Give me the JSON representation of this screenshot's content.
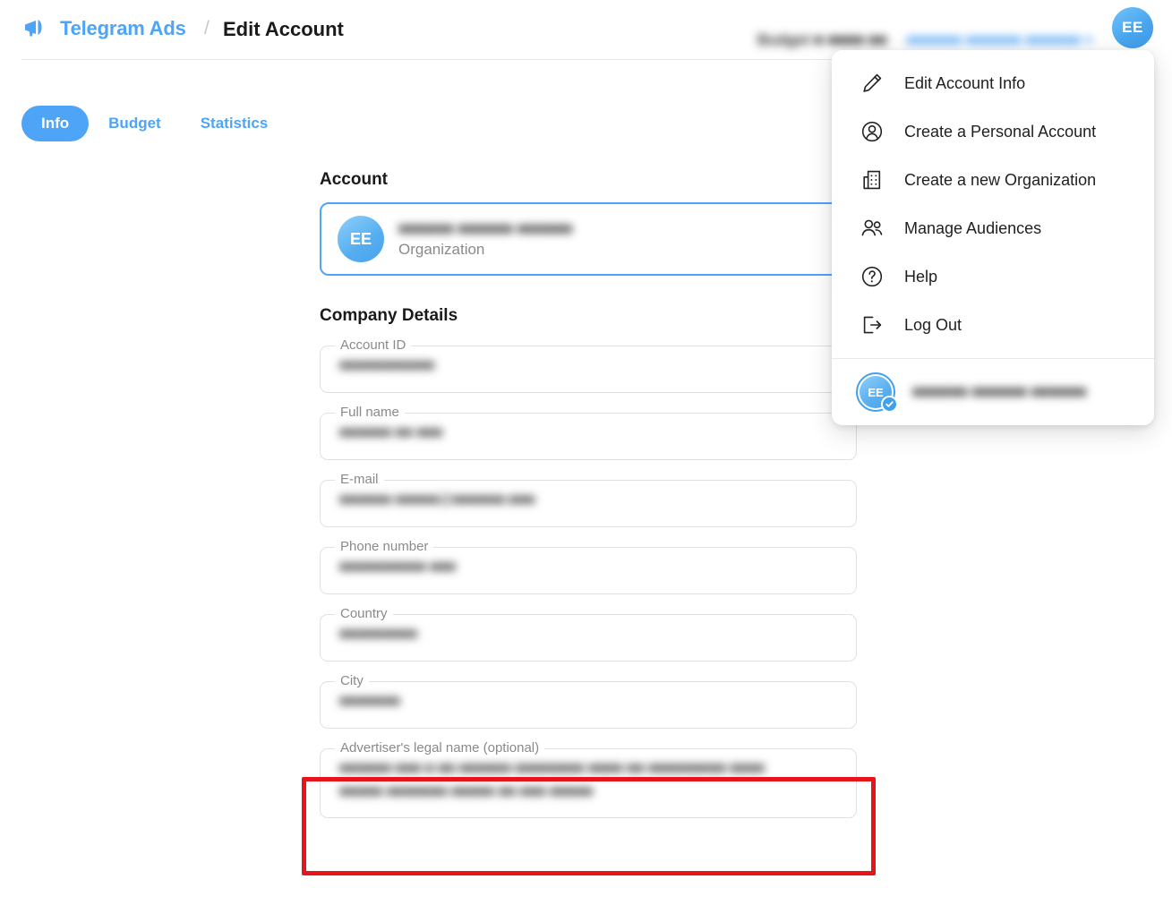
{
  "header": {
    "brand": "Telegram Ads",
    "breadcrumb_separator": "/",
    "page_title": "Edit Account",
    "logo_icon": "megaphone-icon",
    "budget_label_redacted": "Budget  ■ ■■■■ ■■",
    "account_name_redacted": "■■■■■■ ■■■■■■ ■■■■■■ ▾",
    "avatar_initials": "EE"
  },
  "tabs": [
    {
      "label": "Info",
      "active": true
    },
    {
      "label": "Budget",
      "active": false
    },
    {
      "label": "Statistics",
      "active": false
    }
  ],
  "main": {
    "account_section_title": "Account",
    "account_card": {
      "avatar_initials": "EE",
      "name_redacted": "■■■■■■ ■■■■■■ ■■■■■■",
      "type": "Organization"
    },
    "company_section_title": "Company Details",
    "fields": [
      {
        "label": "Account ID",
        "value_redacted": "■■■■■■■■■■■",
        "tall": false
      },
      {
        "label": "Full name",
        "value_redacted": "■■■■■■ ■■ ■■■",
        "tall": false
      },
      {
        "label": "E-mail",
        "value_redacted": "■■■■■■ ■■■■■@■■■■■■.■■■",
        "tall": false
      },
      {
        "label": "Phone number",
        "value_redacted": "■■■■■■■■■■ ■■■",
        "tall": false
      },
      {
        "label": "Country",
        "value_redacted": "■■■■■■■■■",
        "tall": false
      },
      {
        "label": "City",
        "value_redacted": "■■■■■■■",
        "tall": false
      },
      {
        "label": "Advertiser's legal name (optional)",
        "value_redacted": "■■■■■■ ■■■ ■ ■■ ■■■■■■ ■■■■■■■■ ■■■■ ■■ ■■■■■■■■■ ■■■■",
        "value_redacted_2": "■■■■■ ■■■■■■■ ■■■■■ ■■ ■■■ ■■■■■",
        "tall": true,
        "highlighted": true
      }
    ]
  },
  "dropdown_menu": {
    "items": [
      {
        "label": "Edit Account Info",
        "icon": "pencil-icon"
      },
      {
        "label": "Create a Personal Account",
        "icon": "user-circle-icon"
      },
      {
        "label": "Create a new Organization",
        "icon": "building-icon"
      },
      {
        "label": "Manage Audiences",
        "icon": "people-icon"
      },
      {
        "label": "Help",
        "icon": "question-circle-icon"
      },
      {
        "label": "Log Out",
        "icon": "logout-icon"
      }
    ],
    "selected_account": {
      "avatar_initials": "EE",
      "name_redacted": "■■■■■■ ■■■■■■ ■■■■■■",
      "check_icon": "check-badge-icon"
    }
  },
  "annotation": {
    "type": "red-highlight-box",
    "target_field": "Advertiser's legal name (optional)",
    "color": "#e8141c"
  },
  "colors": {
    "accent_blue": "#4ea4f6",
    "annotation_red": "#e8141c",
    "text_dark": "#1a1a1a",
    "text_muted": "#8a8a8a",
    "field_border": "#dfe1e3"
  }
}
